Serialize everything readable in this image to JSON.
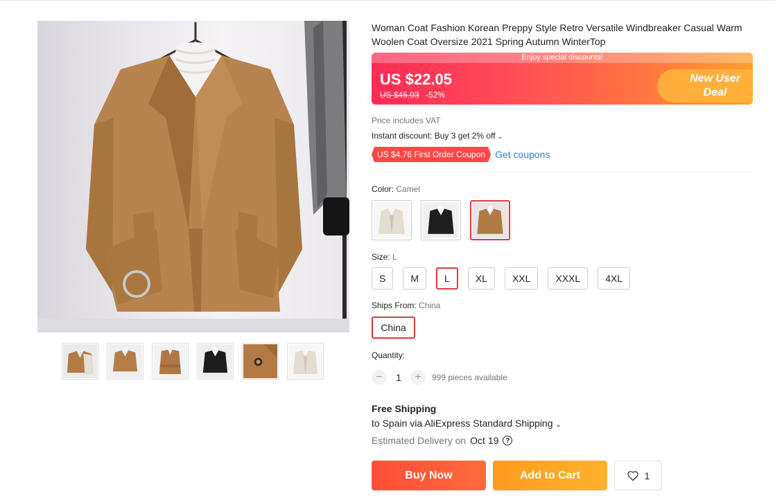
{
  "product": {
    "title": "Woman Coat Fashion Korean Preppy Style Retro Versatile Windbreaker Casual Warm Woolen Coat Oversize 2021 Spring Autumn WinterTop"
  },
  "price": {
    "banner_text": "Enjoy special discounts!",
    "current": "US $22.05",
    "original": "US $45.93",
    "discount": "-52%",
    "deal_line1": "New User",
    "deal_line2": "Deal"
  },
  "vat_text": "Price includes VAT",
  "instant_discount": "Instant discount: Buy 3 get 2% off",
  "coupon": {
    "tag": "US $4.76 First Order Coupon",
    "link": "Get coupons"
  },
  "color": {
    "label": "Color:",
    "selected": "Camel",
    "options": [
      {
        "name": "beige-coat-swatch",
        "color": "#e6e0d6"
      },
      {
        "name": "black-coat-swatch",
        "color": "#1e1e1e"
      },
      {
        "name": "camel-coat-swatch",
        "color": "#b07a45"
      }
    ]
  },
  "size": {
    "label": "Size:",
    "selected": "L",
    "options": [
      "S",
      "M",
      "L",
      "XL",
      "XXL",
      "XXXL",
      "4XL"
    ]
  },
  "ships_from": {
    "label": "Ships From:",
    "selected": "China",
    "option": "China"
  },
  "quantity": {
    "label": "Quantity:",
    "minus": "−",
    "value": "1",
    "plus": "+",
    "available": "999 pieces available"
  },
  "shipping": {
    "free": "Free Shipping",
    "to": "to Spain via AliExpress Standard Shipping",
    "estimated_label": "Estimated Delivery on",
    "estimated_date": "Oct 19",
    "help": "?"
  },
  "actions": {
    "buy_now": "Buy Now",
    "add_to_cart": "Add to Cart",
    "wishlist_count": "1"
  },
  "colors": {
    "accent_red": "#e0383e",
    "link_blue": "#2e7fd6",
    "coupon_red": "#ff4747",
    "buy_orange": "#ff5a3b",
    "cart_orange": "#ffa326",
    "camel": "#b07a45"
  }
}
